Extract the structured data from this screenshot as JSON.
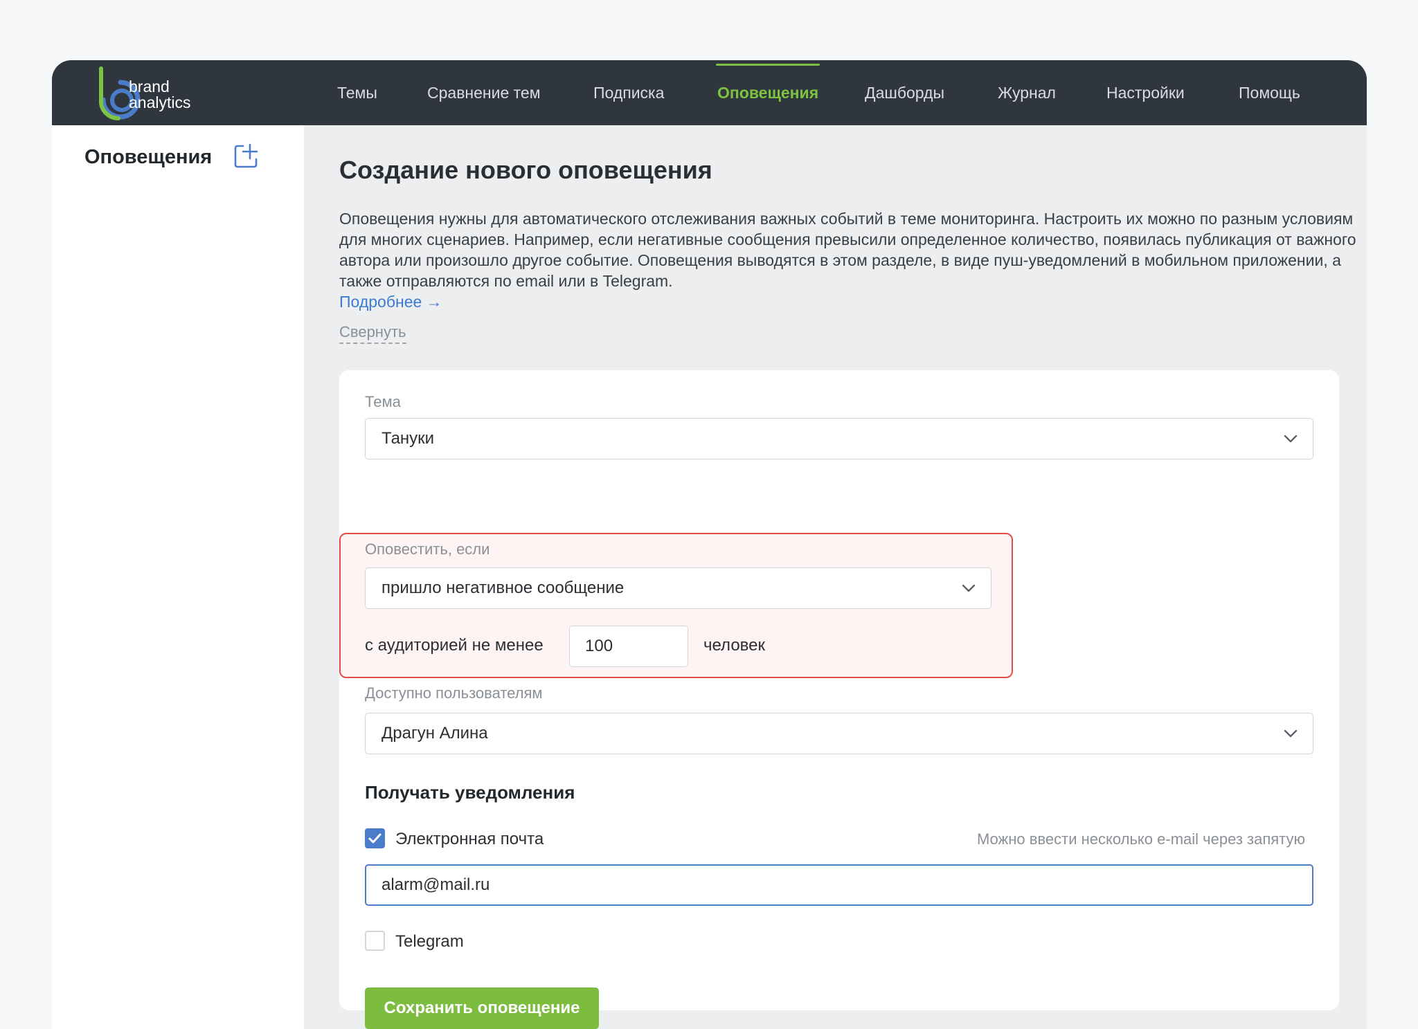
{
  "brand": {
    "line1": "brand",
    "line2": "analytics"
  },
  "nav": {
    "items": [
      {
        "label": "Темы"
      },
      {
        "label": "Сравнение тем"
      },
      {
        "label": "Подписка"
      },
      {
        "label": "Оповещения",
        "active": true
      },
      {
        "label": "Дашборды"
      },
      {
        "label": "Журнал"
      },
      {
        "label": "Настройки"
      },
      {
        "label": "Помощь"
      }
    ]
  },
  "sidebar": {
    "title": "Оповещения",
    "add_icon": "plus-square-icon"
  },
  "main": {
    "title": "Создание нового оповещения",
    "description": "Оповещения нужны для автоматического отслеживания важных событий в теме мониторинга. Настроить их можно по разным условиям для многих сценариев. Например, если негативные сообщения превысили определенное количество, появилась публикация от важного автора или произошло другое событие. Оповещения выводятся в этом разделе, в виде пуш-уведомлений в мобильном приложении, а также отправляются по email или в Telegram.",
    "more_link": "Подробнее →",
    "collapse_link": "Свернуть"
  },
  "form": {
    "topic": {
      "label": "Тема",
      "value": "Тануки"
    },
    "condition": {
      "label": "Оповестить, если",
      "value": "пришло негативное сообщение",
      "audience_prefix": "с аудиторией не менее",
      "audience_value": "100",
      "audience_suffix": "человек"
    },
    "users": {
      "label": "Доступно пользователям",
      "value": "Драгун Алина"
    },
    "notifications": {
      "title": "Получать уведомления",
      "email": {
        "label": "Электронная почта",
        "checked": true,
        "hint": "Можно ввести несколько e-mail через запятую",
        "value": "alarm@mail.ru"
      },
      "telegram": {
        "label": "Telegram",
        "checked": false
      }
    },
    "save_label": "Сохранить оповещение"
  },
  "colors": {
    "topbar": "#2f363d",
    "accent_green": "#7dc241",
    "button_green": "#7cbd3f",
    "link_blue": "#3c7bd1",
    "checkbox_blue": "#4a7cc9",
    "highlight_red": "#e64b4b"
  }
}
